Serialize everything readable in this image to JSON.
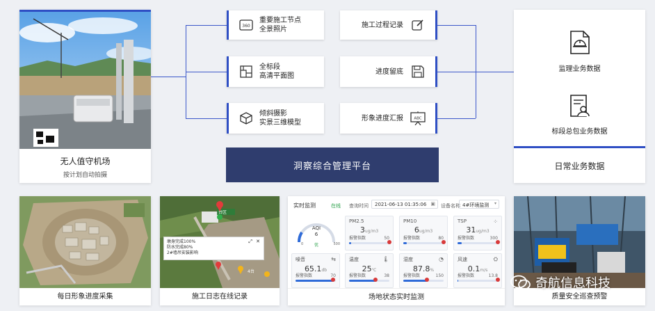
{
  "left_card": {
    "title": "无人值守机场",
    "subtitle": "按计划自动拍摄"
  },
  "left_nodes": [
    {
      "line1": "重要施工节点",
      "line2": "全景照片",
      "icon": "360-icon"
    },
    {
      "line1": "全标段",
      "line2": "高清平面图",
      "icon": "floorplan-icon"
    },
    {
      "line1": "倾斜摄影",
      "line2": "实景三维模型",
      "icon": "cube-icon"
    }
  ],
  "right_nodes": [
    {
      "label": "施工过程记录",
      "icon": "edit-icon"
    },
    {
      "label": "进度留底",
      "icon": "save-icon"
    },
    {
      "label": "形象进度汇报",
      "icon": "presentation-icon",
      "icon_text": "ABC"
    }
  ],
  "platform": {
    "label": "洞察综合管理平台"
  },
  "right_card": {
    "items": [
      {
        "label": "监理业务数据",
        "icon": "helmet-document-icon"
      },
      {
        "label": "标段总包业务数据",
        "icon": "person-document-icon"
      }
    ],
    "title": "日常业务数据"
  },
  "bottom": {
    "photo1_caption": "每日形象进度采集",
    "photo2_caption": "施工日志在线记录",
    "photo2_popup": [
      "墩身完成100%",
      "防水完成80%",
      "2#墙吊安装影响"
    ],
    "photo2_tags": [
      "台区",
      "4台"
    ],
    "monitor_caption": "场地状态实时监测",
    "photo4_caption": "质量安全巡查预警"
  },
  "monitor": {
    "title": "实时监测",
    "status": "在线",
    "query_label": "查询时间",
    "datetime": "2021-06-13 01:35:06",
    "device_label": "设备名称",
    "device_value": "4#环境监测",
    "aqi": {
      "label": "AQI",
      "value": "6",
      "quality": "优",
      "min": "0",
      "max": "500"
    },
    "index_label": "报警指数",
    "sensors": [
      {
        "name": "PM2.5",
        "value": "3",
        "unit": "ug/m3",
        "max": "50",
        "fill": 0.06,
        "mark": 1.0
      },
      {
        "name": "PM10",
        "value": "6",
        "unit": "ug/m3",
        "max": "80",
        "fill": 0.08,
        "mark": 1.0
      },
      {
        "name": "TSP",
        "value": "31",
        "unit": "ug/m3",
        "max": "300",
        "fill": 0.1,
        "mark": 1.0
      },
      {
        "name": "噪音",
        "value": "65.1",
        "unit": "db",
        "max": "70",
        "fill": 0.93,
        "mark": 0.93
      },
      {
        "name": "温度",
        "value": "25",
        "unit": "℃",
        "max": "38",
        "fill": 0.66,
        "mark": 0.66
      },
      {
        "name": "湿度",
        "value": "87.8",
        "unit": "%",
        "max": "150",
        "fill": 0.58,
        "mark": 0.58
      },
      {
        "name": "风速",
        "value": "0.1",
        "unit": "m/s",
        "max": "13.8",
        "fill": 0.01,
        "mark": 1.0
      }
    ]
  },
  "watermark": "奇航信息科技"
}
